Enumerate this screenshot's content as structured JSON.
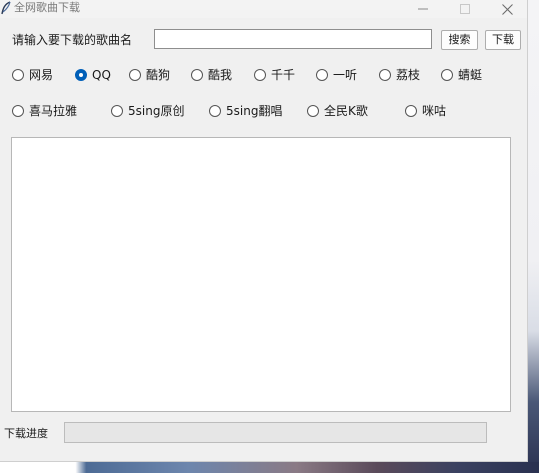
{
  "window": {
    "title": "全网歌曲下载"
  },
  "search": {
    "label": "请输入要下载的歌曲名",
    "input_value": "",
    "search_button": "搜索",
    "download_button": "下载"
  },
  "sources": {
    "selected": "QQ",
    "row1": [
      "网易",
      "QQ",
      "酷狗",
      "酷我",
      "千千",
      "一听",
      "荔枝",
      "蜻蜓"
    ],
    "row2": [
      "喜马拉雅",
      "5sing原创",
      "5sing翻唱",
      "全民K歌",
      "咪咕"
    ]
  },
  "results": {
    "items": []
  },
  "progress": {
    "label": "下载进度",
    "value": 0
  },
  "colors": {
    "accent": "#005fb8",
    "window_bg": "#f0f0f0"
  }
}
